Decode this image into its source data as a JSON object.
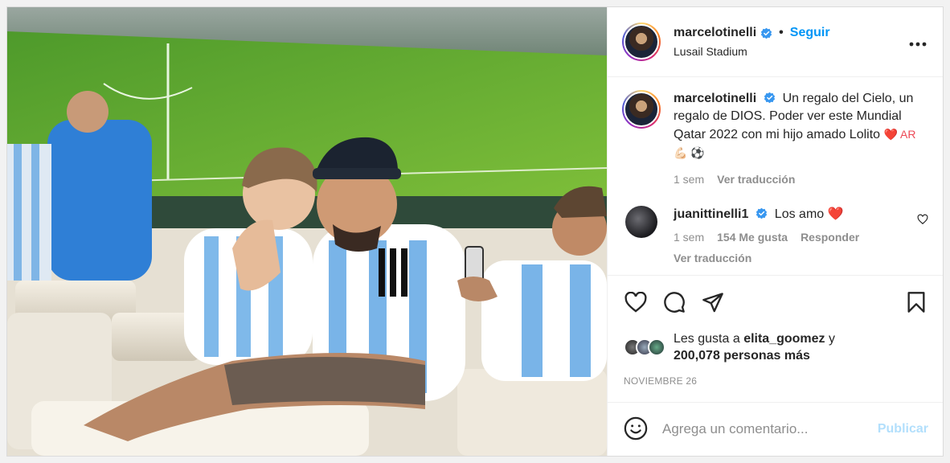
{
  "header": {
    "username": "marcelotinelli",
    "dot": "•",
    "follow_label": "Seguir",
    "location": "Lusail Stadium",
    "more_label": "•••"
  },
  "caption": {
    "username": "marcelotinelli",
    "text": "Un regalo del Cielo, un regalo de DIOS. Poder ver este Mundial Qatar 2022 con mi hijo amado Lolito",
    "emoji_text": "❤️ AR 💪🏻 ⚽",
    "time": "1 sem",
    "translate_label": "Ver traducción"
  },
  "comment": {
    "username": "juanittinelli1",
    "text": "Los amo",
    "emoji": "❤️",
    "time": "1 sem",
    "likes": "154 Me gusta",
    "reply_label": "Responder",
    "translate_label": "Ver traducción"
  },
  "likes": {
    "prefix": "Les gusta a",
    "user": "elita_goomez",
    "conj": "y",
    "others": "200,078 personas más"
  },
  "date": "NOVIEMBRE 26",
  "add_comment": {
    "placeholder": "Agrega un comentario...",
    "publish_label": "Publicar"
  },
  "colors": {
    "accent": "#0095f6",
    "publish_disabled": "#b2dffc",
    "verified": "#3897f0",
    "heart_red": "#ed4956"
  },
  "icons": [
    "verified-icon",
    "more-options-icon",
    "like-icon",
    "comment-icon",
    "share-icon",
    "save-icon",
    "emoji-icon",
    "comment-like-icon"
  ]
}
